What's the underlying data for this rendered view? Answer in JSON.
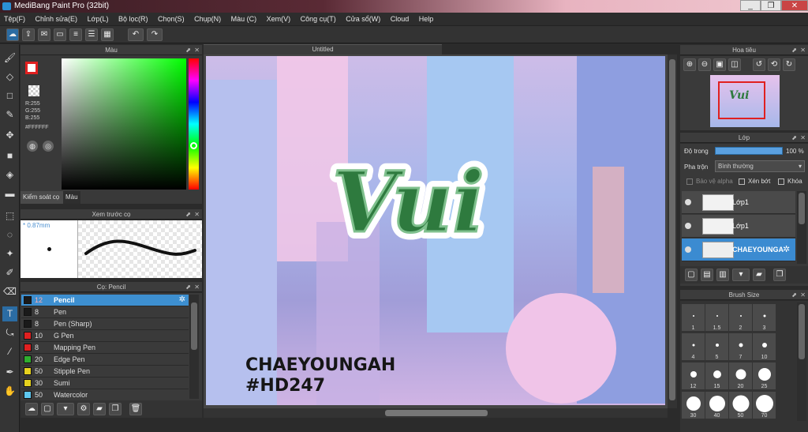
{
  "window": {
    "title": "MediBang Paint Pro (32bit)",
    "minimize": "_",
    "restore": "❐",
    "close": "✕"
  },
  "menu": [
    "Tệp(F)",
    "Chỉnh sửa(E)",
    "Lớp(L)",
    "Bộ lọc(R)",
    "Chọn(S)",
    "Chụp(N)",
    "Màu (C)",
    "Xem(V)",
    "Công cụ(T)",
    "Cửa sổ(W)",
    "Cloud",
    "Help"
  ],
  "toolbar": {
    "undo": "↶",
    "redo": "↷"
  },
  "color_panel": {
    "title": "Màu",
    "r": "R:255",
    "g": "G:255",
    "b": "B:255",
    "hex": "#FFFFFF",
    "tab_brush_control": "Kiểm soát cọ",
    "tab_color": "Màu"
  },
  "brush_preview": {
    "title": "Xem trước cọ",
    "size": "0.87mm"
  },
  "brush_panel": {
    "title": "Cọ: Pencil",
    "brushes": [
      {
        "size": "12",
        "name": "Pencil",
        "color": "#1a1a1a",
        "selected": true
      },
      {
        "size": "8",
        "name": "Pen",
        "color": "#1a1a1a"
      },
      {
        "size": "8",
        "name": "Pen (Sharp)",
        "color": "#1a1a1a"
      },
      {
        "size": "10",
        "name": "G Pen",
        "color": "#e02020"
      },
      {
        "size": "8",
        "name": "Mapping Pen",
        "color": "#e02020"
      },
      {
        "size": "20",
        "name": "Edge Pen",
        "color": "#2fae2f"
      },
      {
        "size": "50",
        "name": "Stipple Pen",
        "color": "#e6d21e"
      },
      {
        "size": "30",
        "name": "Sumi",
        "color": "#e6d21e"
      },
      {
        "size": "50",
        "name": "Watercolor",
        "color": "#5ec8f0"
      }
    ]
  },
  "canvas": {
    "tab": "Untitled",
    "artwork_text": "Vui",
    "caption_line1": "CHAEYOUNGAH",
    "caption_line2": "#HD247"
  },
  "navigator": {
    "title": "Hoa tiêu",
    "thumb_text": "Vui"
  },
  "layers": {
    "title": "Lớp",
    "opacity_label": "Độ trong",
    "opacity_value": "100 %",
    "blend_label": "Pha trộn",
    "blend_value": "Bình thường",
    "protect_alpha": "Bảo vệ alpha",
    "clipping": "Xén bớt",
    "lock": "Khóa",
    "items": [
      {
        "name": "Lớp1",
        "selected": false
      },
      {
        "name": "Lớp1",
        "selected": false
      },
      {
        "name": "CHAEYOUNGA",
        "selected": true
      }
    ]
  },
  "brush_size": {
    "title": "Brush Size",
    "rows": [
      [
        "1",
        "1.5",
        "2",
        "3"
      ],
      [
        "4",
        "5",
        "7",
        "10"
      ],
      [
        "12",
        "15",
        "20",
        "25"
      ],
      [
        "30",
        "40",
        "50",
        "70"
      ]
    ]
  }
}
